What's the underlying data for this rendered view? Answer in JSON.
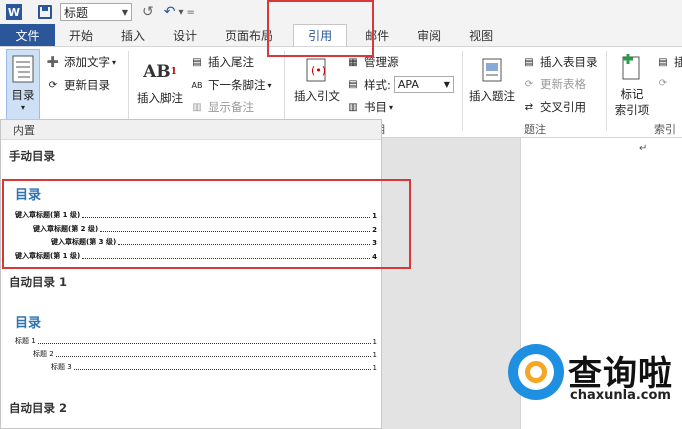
{
  "qat": {
    "style_value": "标题"
  },
  "tabs": [
    {
      "label": "文件"
    },
    {
      "label": "开始"
    },
    {
      "label": "插入"
    },
    {
      "label": "设计"
    },
    {
      "label": "页面布局"
    },
    {
      "label": "引用"
    },
    {
      "label": "邮件"
    },
    {
      "label": "审阅"
    },
    {
      "label": "视图"
    }
  ],
  "ribbon": {
    "toc": {
      "label": "目录"
    },
    "add_text": "添加文字",
    "update_toc": "更新目录",
    "insert_footnote": "插入脚注",
    "insert_endnote": "插入尾注",
    "next_footnote": "下一条脚注",
    "show_notes": "显示备注",
    "insert_citation": "插入引文",
    "manage_sources": "管理源",
    "style_label": "样式:",
    "style_value": "APA",
    "bibliography": "书目",
    "citation_group_label": "书目",
    "insert_caption": "插入题注",
    "insert_table_of_figures": "插入表目录",
    "update_table": "更新表格",
    "cross_reference": "交叉引用",
    "captions_group_label": "题注",
    "mark_entry": "标记",
    "mark_entry_2": "索引项",
    "index_group_label": "索引",
    "cut_insert": "插"
  },
  "gallery": {
    "header": "内置",
    "manual_title": "手动目录",
    "manual_toc_heading": "目录",
    "manual_lines": [
      {
        "text": "键入章标题(第 1 级)",
        "page": "1"
      },
      {
        "text": "键入章标题(第 2 级)",
        "page": "2"
      },
      {
        "text": "键入章标题(第 3 级)",
        "page": "3"
      },
      {
        "text": "键入章标题(第 1 级)",
        "page": "4"
      }
    ],
    "auto1_title": "自动目录 1",
    "auto1_toc_heading": "目录",
    "auto1_lines": [
      {
        "text": "标题 1",
        "page": "1"
      },
      {
        "text": "标题 2",
        "page": "1"
      },
      {
        "text": "标题 3",
        "page": "1"
      }
    ],
    "auto2_title": "自动目录 2"
  },
  "watermark": {
    "title": "查询啦",
    "domain": "chaxunla.com"
  },
  "colors": {
    "accent": "#2b579a",
    "highlight": "#d9383a",
    "toc_heading": "#2e74b5"
  }
}
